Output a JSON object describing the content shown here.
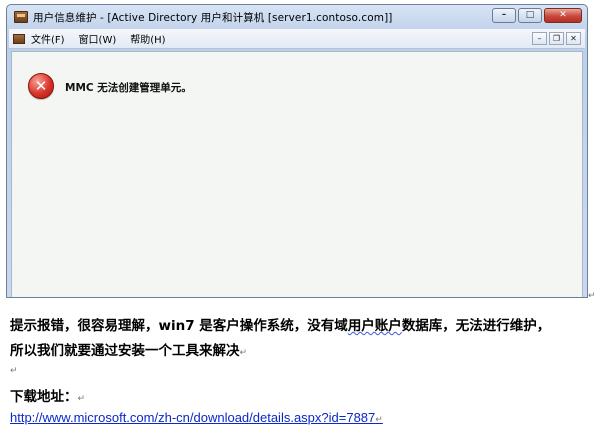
{
  "mmc_window": {
    "title": "用户信息维护 - [Active Directory 用户和计算机 [server1.contoso.com]]",
    "controls": {
      "minimize": "–",
      "maximize": "□",
      "close": "✕"
    },
    "menu": [
      "文件(F)",
      "窗口(W)",
      "帮助(H)"
    ],
    "mdi_controls": {
      "minimize": "–",
      "restore": "❐",
      "close": "✕"
    },
    "error_icon_glyph": "✕",
    "error_message": "MMC 无法创建管理单元。"
  },
  "paragraph_mark": "↵",
  "document": {
    "line1_before": "提示报错，很容易理解，win7 是客户操作系统，没有域",
    "line1_underlined": "用户账户",
    "line1_after": "数据库，无法进行维护，",
    "line2": "所以我们就要通过安装一个工具来解决",
    "download_label": "下载地址：",
    "download_url": "http://www.microsoft.com/zh-cn/download/details.aspx?id=7887"
  },
  "colors": {
    "link": "#0b28c9",
    "error_red": "#d9342a",
    "window_frame": "#c4d5ec"
  }
}
